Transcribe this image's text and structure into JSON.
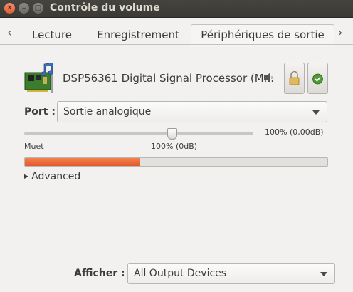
{
  "window": {
    "title": "Contrôle du volume"
  },
  "tabs": [
    {
      "label": "Lecture"
    },
    {
      "label": "Enregistrement"
    },
    {
      "label": "Périphériques de sortie",
      "active": true
    }
  ],
  "device": {
    "name": "DSP56361 Digital Signal Processor (M...",
    "port_label": "Port :",
    "port_value": "Sortie analogique",
    "volume_level_percent": 100,
    "volume_right_label": "100% (0,00dB)",
    "mute_label": "Muet",
    "mid_label": "100% (0dB)",
    "meter_level_fraction": 0.38,
    "advanced_label": "Advanced"
  },
  "footer": {
    "show_label": "Afficher :",
    "show_value": "All Output Devices"
  },
  "colors": {
    "titlebar": "#3b3a36",
    "close_button": "#e15f35",
    "meter_fill": "#e2592b",
    "background": "#f2f1f0"
  },
  "icons": [
    "close-icon",
    "minimize-icon",
    "maximize-icon",
    "chevron-left-icon",
    "chevron-right-icon",
    "sound-card-icon",
    "speaker-icon",
    "lock-icon",
    "checkmark-icon"
  ]
}
